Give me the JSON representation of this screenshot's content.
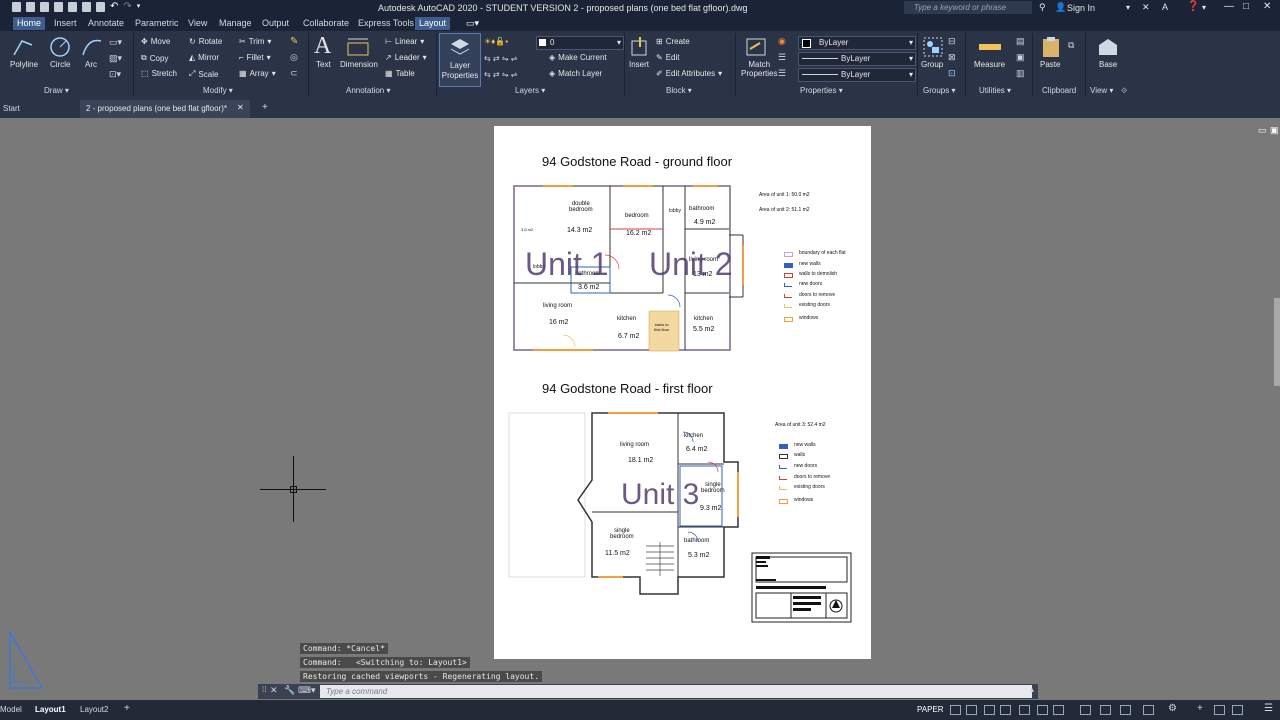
{
  "titlebar": {
    "app_title": "Autodesk AutoCAD 2020 - STUDENT VERSION    2 - proposed plans (one bed flat gfloor).dwg",
    "search_placeholder": "Type a keyword or phrase",
    "sign_in": "Sign In"
  },
  "ribbon_tabs": [
    "Home",
    "Insert",
    "Annotate",
    "Parametric",
    "View",
    "Manage",
    "Output",
    "Collaborate",
    "Express Tools",
    "Layout"
  ],
  "ribbon": {
    "draw": {
      "label": "Draw",
      "polyline": "Polyline",
      "circle": "Circle",
      "arc": "Arc"
    },
    "modify": {
      "label": "Modify",
      "move": "Move",
      "rotate": "Rotate",
      "trim": "Trim",
      "copy": "Copy",
      "mirror": "Mirror",
      "fillet": "Fillet",
      "stretch": "Stretch",
      "scale": "Scale",
      "array": "Array"
    },
    "annotation": {
      "label": "Annotation",
      "text": "Text",
      "dimension": "Dimension",
      "linear": "Linear",
      "leader": "Leader",
      "table": "Table"
    },
    "layers": {
      "label": "Layers",
      "layer_properties_l1": "Layer",
      "layer_properties_l2": "Properties",
      "current_layer": "0",
      "make_current": "Make Current",
      "match_layer": "Match Layer"
    },
    "block": {
      "label": "Block",
      "insert": "Insert",
      "create": "Create",
      "edit": "Edit",
      "edit_attributes": "Edit Attributes"
    },
    "properties": {
      "label": "Properties",
      "match_l1": "Match",
      "match_l2": "Properties",
      "color": "ByLayer",
      "linetype": "ByLayer",
      "lineweight": "ByLayer"
    },
    "groups": {
      "label": "Groups",
      "group": "Group"
    },
    "utilities": {
      "label": "Utilities",
      "measure": "Measure"
    },
    "clipboard": {
      "label": "Clipboard",
      "paste": "Paste"
    },
    "view": {
      "label": "View",
      "base": "Base"
    }
  },
  "doc_tabs": {
    "start": "Start",
    "active": "2 - proposed plans (one bed flat gfloor)*"
  },
  "drawing": {
    "ground_title": "94 Godstone Road - ground floor",
    "first_title": "94 Godstone Road - first floor",
    "area_unit1": "Area of unit 1:  50.0 m2",
    "area_unit2": "Area of unit 2:  51.1 m2",
    "area_unit3": "Area of unit 3: 52.4 m2",
    "unit1": "Unit 1",
    "unit2": "Unit 2",
    "unit3": "Unit 3",
    "rooms_ground": [
      {
        "name": "double\nbedroom",
        "area": "14.3 m2"
      },
      {
        "name": "bedroom",
        "area": "16.2 m2"
      },
      {
        "name": "lobby",
        "area": ""
      },
      {
        "name": "bathroom",
        "area": "4.9 m2"
      },
      {
        "name": "3.6 m2",
        "area": ""
      },
      {
        "name": "lobby",
        "area": ""
      },
      {
        "name": "bathroom",
        "area": "3.6 m2"
      },
      {
        "name": "living room",
        "area": "13 m2"
      },
      {
        "name": "living room",
        "area": "16 m2"
      },
      {
        "name": "kitchen",
        "area": "6.7 m2"
      },
      {
        "name": "stairs to\nfirst floor",
        "area": ""
      },
      {
        "name": "kitchen",
        "area": "5.5 m2"
      }
    ],
    "rooms_first": [
      {
        "name": "living room",
        "area": "18.1 m2"
      },
      {
        "name": "kitchen",
        "area": "6.4 m2"
      },
      {
        "name": "single\nbedroom",
        "area": "9.3 m2"
      },
      {
        "name": "single\nbedroom",
        "area": "11.5 m2"
      },
      {
        "name": "bathroom",
        "area": "5.3 m2"
      }
    ],
    "legend_ground": [
      "boundary of each flat",
      "new walls",
      "walls to demolish",
      "new doors",
      "doors to remove",
      "existing doors",
      "windows"
    ],
    "legend_first": [
      "new walls",
      "walls",
      "new doors",
      "doors to remove",
      "existing doors",
      "windows"
    ]
  },
  "command_history": [
    "Command: *Cancel*",
    "Command:   <Switching to: Layout1>",
    "Restoring cached viewports - Regenerating layout."
  ],
  "command_placeholder": "Type a command",
  "status": {
    "tabs": [
      "Model",
      "Layout1",
      "Layout2"
    ],
    "paper": "PAPER"
  }
}
